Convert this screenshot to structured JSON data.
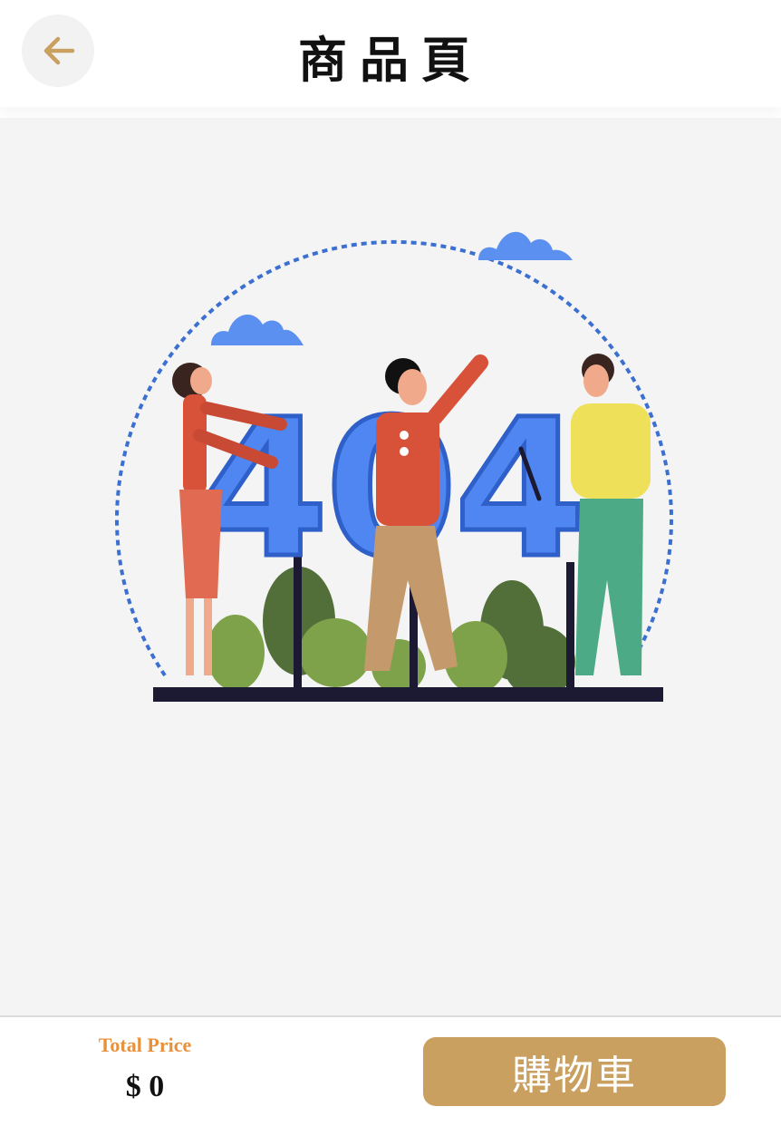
{
  "header": {
    "title": "商品頁",
    "back_icon": "arrow-left-icon"
  },
  "main": {
    "illustration": "404-error-illustration",
    "illustration_text": "404"
  },
  "footer": {
    "total_label": "Total Price",
    "total_value": "$ 0",
    "cart_button_label": "購物車"
  },
  "colors": {
    "accent": "#c9a060",
    "total_label": "#e8913a",
    "background": "#f4f4f4",
    "illustration_blue": "#4f86f2"
  }
}
